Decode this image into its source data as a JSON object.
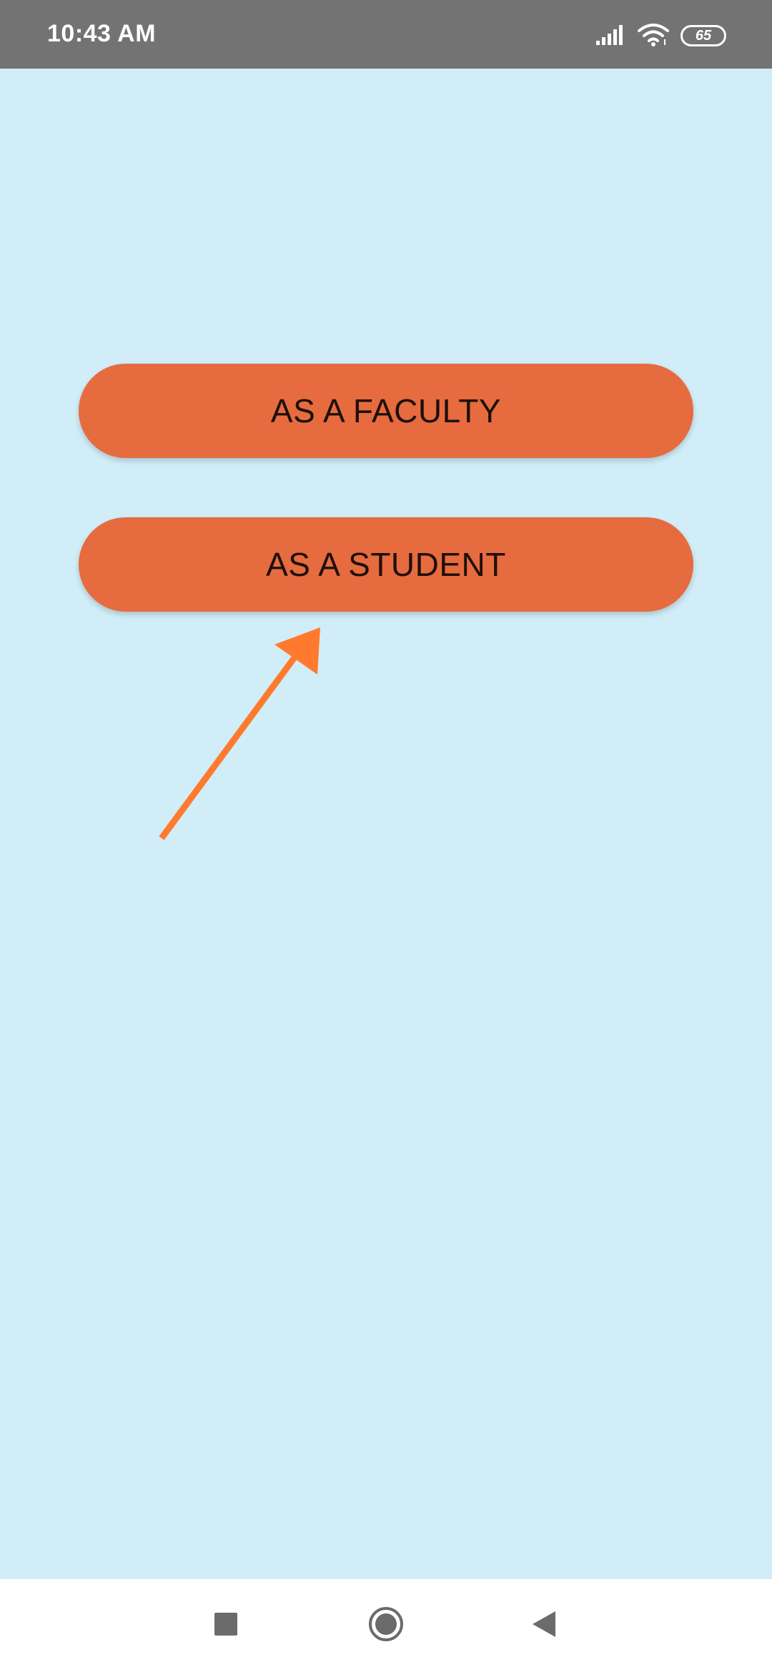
{
  "status_bar": {
    "time": "10:43 AM",
    "battery_level": "65",
    "icons": [
      "signal-icon",
      "wifi-icon",
      "battery-icon"
    ]
  },
  "main": {
    "buttons": [
      {
        "label": "AS A FACULTY"
      },
      {
        "label": "AS A STUDENT"
      }
    ]
  },
  "annotation": {
    "icon": "arrow-icon",
    "color": "#ff7a2e"
  },
  "nav_bar": {
    "icons": [
      "recents-icon",
      "home-icon",
      "back-icon"
    ]
  },
  "colors": {
    "background": "#d1edf8",
    "button": "#e66b3f",
    "status_bar": "#737373"
  }
}
